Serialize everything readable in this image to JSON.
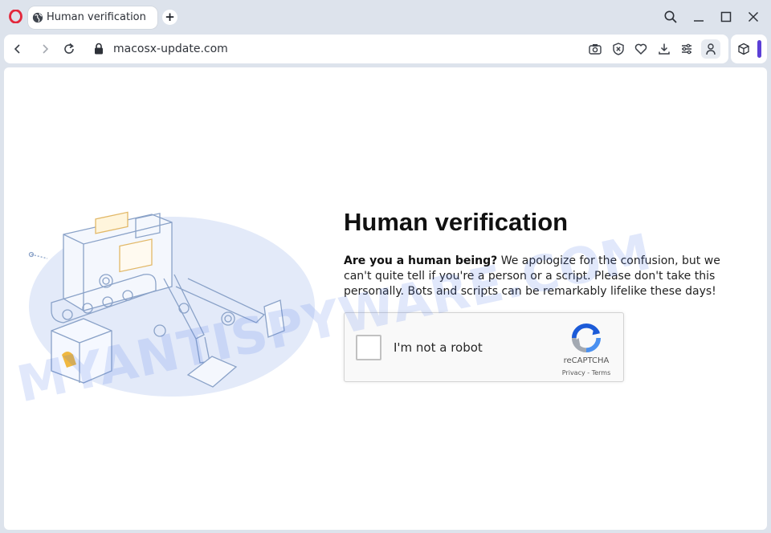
{
  "browser": {
    "tab_title": "Human verification",
    "new_tab_label": "+",
    "url": "macosx-update.com"
  },
  "icons": {
    "opera": "opera-logo-icon",
    "tab_favicon": "globe-icon",
    "search": "search-icon",
    "minimize": "minimize-icon",
    "maximize": "maximize-icon",
    "close": "close-icon",
    "back": "back-arrow-icon",
    "forward": "forward-arrow-icon",
    "reload": "reload-icon",
    "lock": "lock-icon",
    "camera": "camera-icon",
    "adblock": "shield-x-icon",
    "heart": "heart-icon",
    "download": "download-icon",
    "easy_setup": "sliders-icon",
    "profile": "person-icon",
    "cube": "cube-icon"
  },
  "colors": {
    "opera_red": "#e3283c",
    "accent": "#5b3fd6",
    "watermark": "#466ee6"
  },
  "page": {
    "headline": "Human verification",
    "lead_bold": "Are you a human being?",
    "lead_text": " We apologize for the confusion, but we can't quite tell if you're a person or a script. Please don't take this personally. Bots and scripts can be remarkably lifelike these days!",
    "captcha": {
      "checkbox_label": "I'm not a robot",
      "brand": "reCAPTCHA",
      "links": "Privacy - Terms"
    }
  },
  "watermark": "MYANTISPYWARE.COM"
}
